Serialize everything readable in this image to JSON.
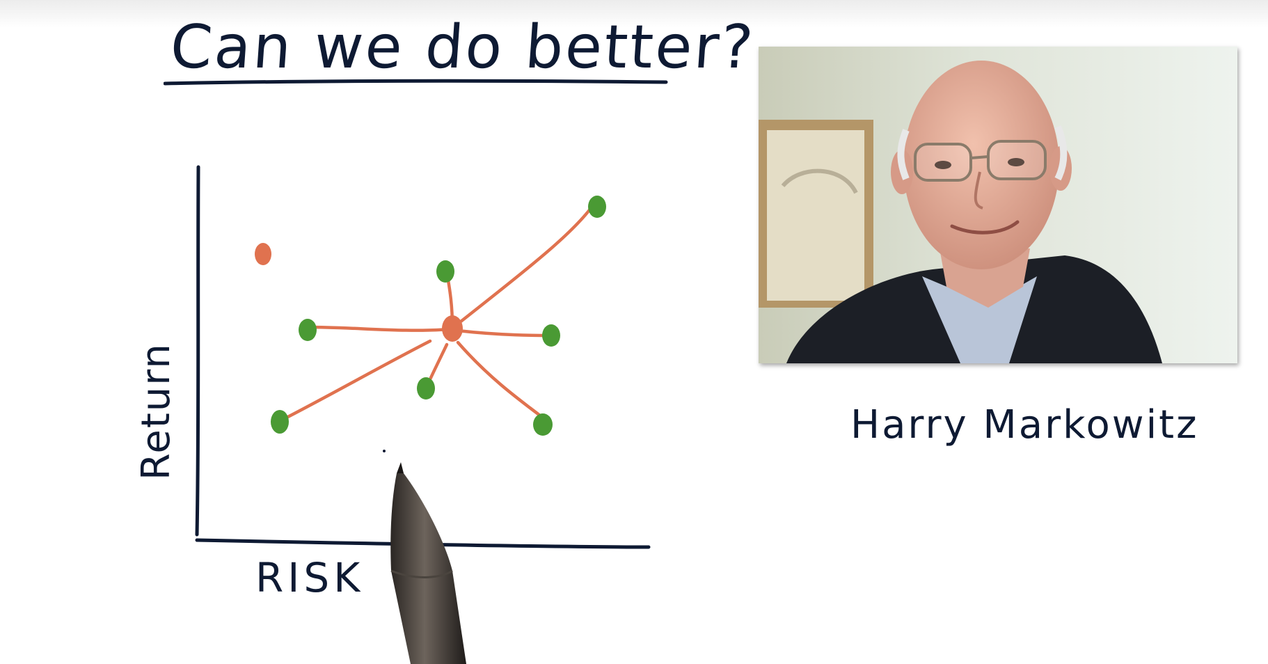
{
  "slide": {
    "title": "Can we do better?",
    "caption": "Harry Markowitz"
  },
  "diagram": {
    "y_axis_label": "Return",
    "x_axis_label": "RISK",
    "center_node_color": "#e0724f",
    "isolated_node_color": "#e0724f",
    "leaf_node_color": "#4a9a34",
    "edge_color": "#e0724f",
    "ink_color": "#0e1a33"
  },
  "photo": {
    "subject": "portrait-of-harry-markowitz"
  }
}
